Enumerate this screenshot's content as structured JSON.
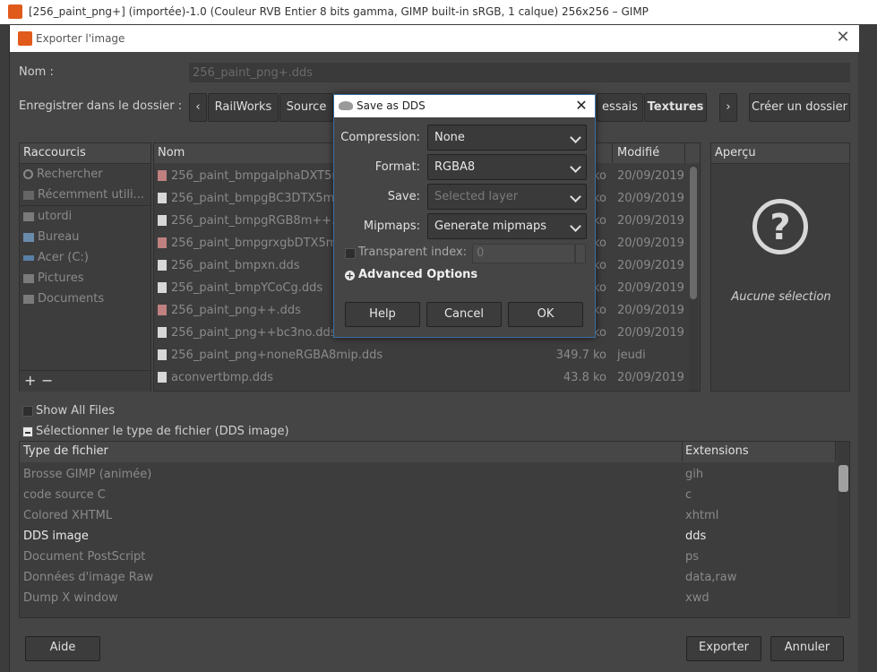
{
  "main_window": {
    "title": "[256_paint_png+] (importée)-1.0 (Couleur RVB Entier 8 bits gamma, GIMP built-in sRGB, 1 calque) 256x256 – GIMP"
  },
  "export_dialog": {
    "title": "Exporter l'image",
    "name_label": "Nom :",
    "name_value": "256_paint_png+.dds",
    "folder_label": "Enregistrer dans le dossier :",
    "path_buttons": [
      "RailWorks",
      "Source",
      "essais",
      "Textures"
    ],
    "create_folder": "Créer un dossier",
    "places_header": "Raccourcis",
    "places": [
      {
        "label": "Rechercher",
        "icon": "search-icon"
      },
      {
        "label": "Récemment utili...",
        "icon": "recent-icon"
      },
      {
        "label": "utordi",
        "icon": "folder-icon"
      },
      {
        "label": "Bureau",
        "icon": "folder-icon"
      },
      {
        "label": "Acer (C:)",
        "icon": "drive-icon"
      },
      {
        "label": "Pictures",
        "icon": "folder-icon"
      },
      {
        "label": "Documents",
        "icon": "folder-icon"
      }
    ],
    "files_header": {
      "name": "Nom",
      "modified": "Modifié"
    },
    "files": [
      {
        "name": "256_paint_bmpgalphaDXT5m",
        "size": "ko",
        "date": "20/09/2019",
        "icon": "image-file-icon"
      },
      {
        "name": "256_paint_bmpgBC3DTX5m",
        "size": "ko",
        "date": "20/09/2019",
        "icon": "file-icon"
      },
      {
        "name": "256_paint_bmpgRGB8m++.",
        "size": "ko",
        "date": "20/09/2019",
        "icon": "file-icon"
      },
      {
        "name": "256_paint_bmpgrxgbDTX5m",
        "size": "ko",
        "date": "20/09/2019",
        "icon": "image-file-icon"
      },
      {
        "name": "256_paint_bmpxn.dds",
        "size": "ko",
        "date": "20/09/2019",
        "icon": "file-icon"
      },
      {
        "name": "256_paint_bmpYCoCg.dds",
        "size": "ko",
        "date": "20/09/2019",
        "icon": "file-icon"
      },
      {
        "name": "256_paint_png++.dds",
        "size": "ko",
        "date": "20/09/2019",
        "icon": "image-file-icon"
      },
      {
        "name": "256_paint_png++bc3no.dds",
        "size": "ko",
        "date": "20/09/2019",
        "icon": "file-icon"
      },
      {
        "name": "256_paint_png+noneRGBA8mip.dds",
        "size": "349.7 ko",
        "date": "jeudi",
        "icon": "file-icon"
      },
      {
        "name": "aconvertbmp.dds",
        "size": "43.8 ko",
        "date": "20/09/2019",
        "icon": "file-icon"
      }
    ],
    "preview_header": "Aperçu",
    "preview_text": "Aucune sélection",
    "show_all_files": "Show All Files",
    "select_type": "Sélectionner le type de fichier (DDS image)",
    "types_header": {
      "type": "Type de fichier",
      "extensions": "Extensions"
    },
    "types": [
      {
        "name": "Brosse GIMP (animée)",
        "ext": "gih"
      },
      {
        "name": "code source C",
        "ext": "c"
      },
      {
        "name": "Colored XHTML",
        "ext": "xhtml"
      },
      {
        "name": "DDS image",
        "ext": "dds",
        "selected": true
      },
      {
        "name": "Document PostScript",
        "ext": "ps"
      },
      {
        "name": "Données d'image Raw",
        "ext": "data,raw"
      },
      {
        "name": "Dump X window",
        "ext": "xwd"
      }
    ],
    "help_button": "Aide",
    "export_button": "Exporter",
    "cancel_button": "Annuler"
  },
  "dds_dialog": {
    "title": "Save as DDS",
    "compression_label": "Compression:",
    "compression_value": "None",
    "format_label": "Format:",
    "format_value": "RGBA8",
    "save_label": "Save:",
    "save_value": "Selected layer",
    "mipmaps_label": "Mipmaps:",
    "mipmaps_value": "Generate mipmaps",
    "transparent_label": "Transparent index:",
    "transparent_value": "0",
    "advanced_label": "Advanced Options",
    "help_button": "Help",
    "cancel_button": "Cancel",
    "ok_button": "OK"
  }
}
